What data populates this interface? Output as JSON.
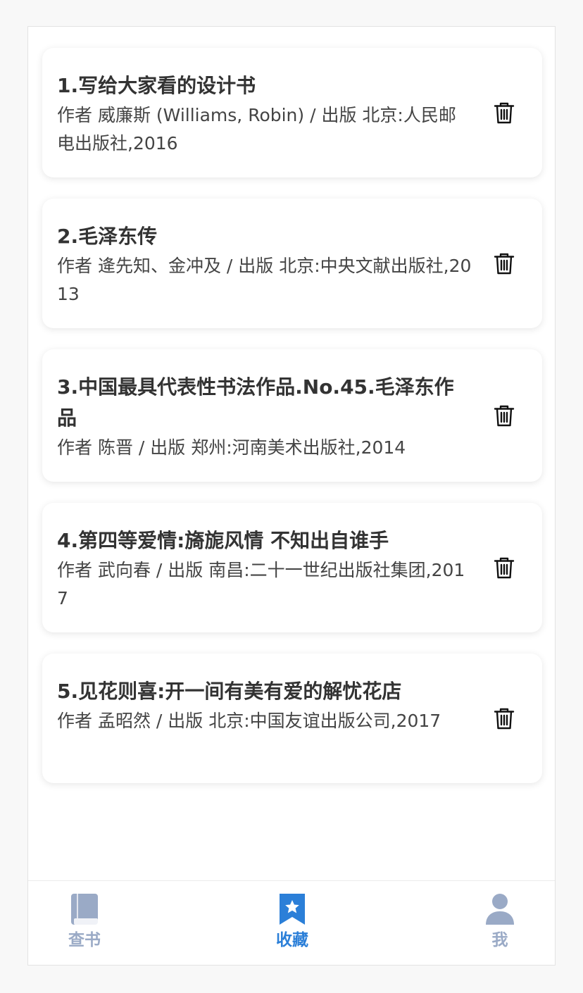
{
  "colors": {
    "accent": "#2b7fd8",
    "inactive_tab": "#9aaac6",
    "title_text": "#333333",
    "meta_text": "#444444"
  },
  "books": [
    {
      "title": "1.写给大家看的设计书",
      "meta": "作者 威廉斯 (Williams, Robin) / 出版 北京:人民邮电出版社,2016",
      "delete_icon": "trash-icon"
    },
    {
      "title": "2.毛泽东传",
      "meta": "作者 逄先知、金冲及 / 出版 北京:中央文献出版社,2013",
      "delete_icon": "trash-icon"
    },
    {
      "title": "3.中国最具代表性书法作品.No.45.毛泽东作品",
      "meta": "作者 陈晋 / 出版 郑州:河南美术出版社,2014",
      "delete_icon": "trash-icon"
    },
    {
      "title": "4.第四等爱情:旖旎风情 不知出自谁手",
      "meta": "作者 武向春 / 出版 南昌:二十一世纪出版社集团,2017",
      "delete_icon": "trash-icon"
    },
    {
      "title": "5.见花则喜:开一间有美有爱的解忧花店",
      "meta": "作者 孟昭然 / 出版 北京:中国友谊出版公司,2017",
      "delete_icon": "trash-icon"
    }
  ],
  "tabbar": {
    "tabs": [
      {
        "label": "查书",
        "icon": "book-icon",
        "active": false
      },
      {
        "label": "收藏",
        "icon": "bookmark-star-icon",
        "active": true
      },
      {
        "label": "我",
        "icon": "user-icon",
        "active": false
      }
    ]
  }
}
